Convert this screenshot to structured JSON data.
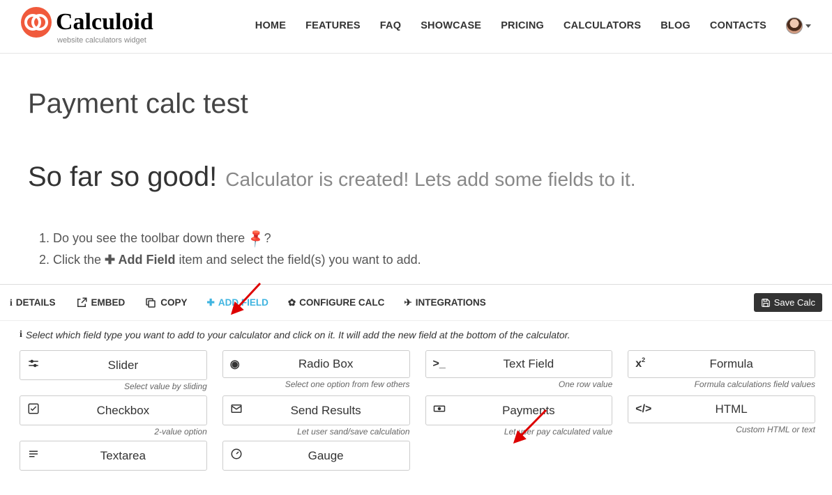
{
  "brand": {
    "name": "Calculoid",
    "tagline": "website calculators widget"
  },
  "nav": {
    "home": "HOME",
    "features": "FEATURES",
    "faq": "FAQ",
    "showcase": "SHOWCASE",
    "pricing": "PRICING",
    "calculators": "CALCULATORS",
    "blog": "BLOG",
    "contacts": "CONTACTS"
  },
  "page": {
    "title": "Payment calc test",
    "heading": "So far so good!",
    "caption": "Calculator is created! Lets add some fields to it.",
    "step1_a": "Do you see the toolbar down there ",
    "step1_b": "?",
    "step2_a": "Click the ",
    "step2_bold": " Add Field",
    "step2_b": " item and select the field(s) you want to add."
  },
  "toolbar": {
    "details": "DETAILS",
    "embed": "EMBED",
    "copy": "COPY",
    "add_field": "ADD FIELD",
    "configure": "CONFIGURE CALC",
    "integrations": "INTEGRATIONS",
    "save": "Save Calc"
  },
  "panel": {
    "help": "Select which field type you want to add to your calculator and click on it. It will add the new field at the bottom of the calculator."
  },
  "fields": {
    "slider": {
      "label": "Slider",
      "desc": "Select value by sliding"
    },
    "radio": {
      "label": "Radio Box",
      "desc": "Select one option from few others"
    },
    "text": {
      "label": "Text Field",
      "desc": "One row value"
    },
    "formula": {
      "label": "Formula",
      "desc": "Formula calculations field values"
    },
    "checkbox": {
      "label": "Checkbox",
      "desc": "2-value option"
    },
    "send": {
      "label": "Send Results",
      "desc": "Let user sand/save calculation"
    },
    "payments": {
      "label": "Payments",
      "desc": "Let user pay calculated value"
    },
    "html": {
      "label": "HTML",
      "desc": "Custom HTML or text"
    },
    "textarea": {
      "label": "Textarea",
      "desc": ""
    },
    "gauge": {
      "label": "Gauge",
      "desc": ""
    }
  }
}
